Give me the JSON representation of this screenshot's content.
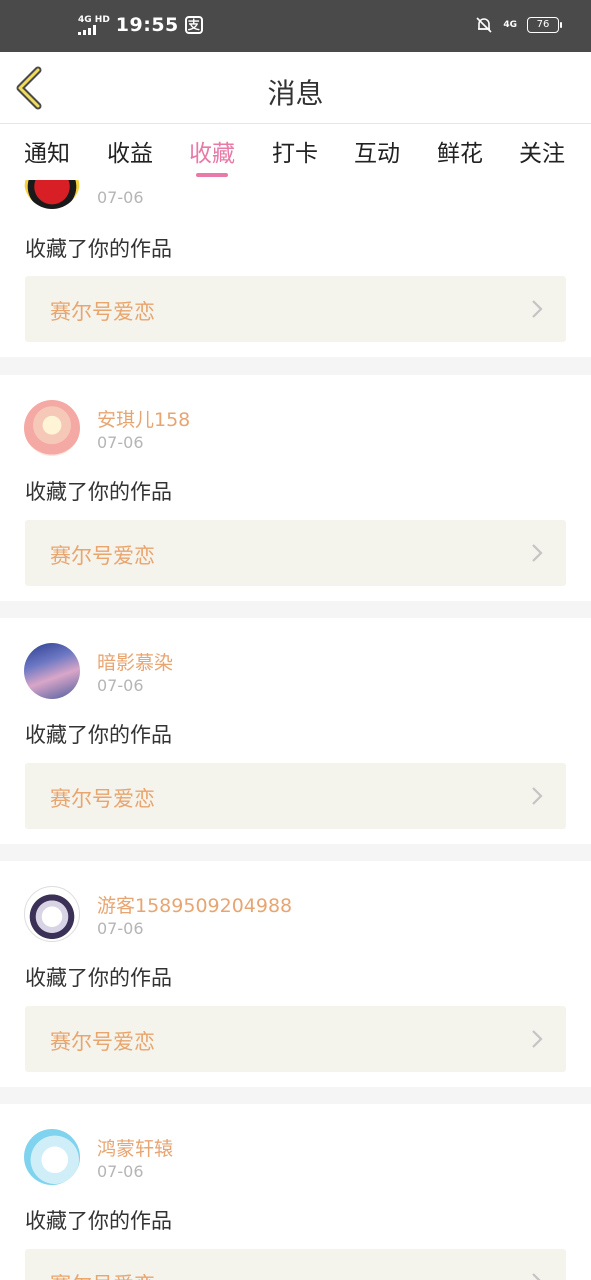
{
  "status_bar": {
    "network": "4G HD",
    "time": "19:55",
    "app_icon_glyph": "支",
    "net_right": "4G",
    "battery": "76"
  },
  "header": {
    "title": "消息",
    "back_icon": "chevron-left-icon"
  },
  "tabs": [
    {
      "label": "通知"
    },
    {
      "label": "收益"
    },
    {
      "label": "收藏",
      "active": true
    },
    {
      "label": "打卡"
    },
    {
      "label": "互动"
    },
    {
      "label": "鲜花"
    },
    {
      "label": "关注"
    }
  ],
  "colors": {
    "accent": "#e77aa6",
    "username": "#e8a572",
    "work_title": "#e9a56e",
    "work_bg": "#f4f3ec"
  },
  "items": [
    {
      "username": "",
      "date": "07-06",
      "action": "收藏了你的作品",
      "work_title": "赛尔号爱恋"
    },
    {
      "username": "安琪儿158",
      "date": "07-06",
      "action": "收藏了你的作品",
      "work_title": "赛尔号爱恋"
    },
    {
      "username": "暗影慕染",
      "date": "07-06",
      "action": "收藏了你的作品",
      "work_title": "赛尔号爱恋"
    },
    {
      "username": "游客1589509204988",
      "date": "07-06",
      "action": "收藏了你的作品",
      "work_title": "赛尔号爱恋"
    },
    {
      "username": "鸿蒙轩辕",
      "date": "07-06",
      "action": "收藏了你的作品",
      "work_title": "赛尔号爱恋"
    }
  ]
}
